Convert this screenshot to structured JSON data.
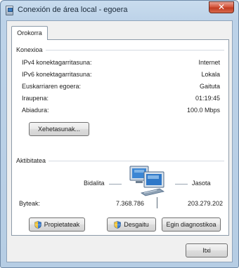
{
  "window": {
    "title": "Conexión de área local - egoera"
  },
  "tabs": [
    {
      "label": "Orokorra"
    }
  ],
  "connection": {
    "label": "Konexioa",
    "rows": [
      {
        "label": "IPv4 konektagarritasuna:",
        "value": "Internet"
      },
      {
        "label": "IPv6 konektagarritasuna:",
        "value": "Lokala"
      },
      {
        "label": "Euskarriaren egoera:",
        "value": "Gaituta"
      },
      {
        "label": "Iraupena:",
        "value": "01:19:45"
      },
      {
        "label": "Abiadura:",
        "value": "100.0 Mbps"
      }
    ],
    "details_button": "Xehetasunak..."
  },
  "activity": {
    "label": "Aktibitatea",
    "sent_label": "Bidalita",
    "received_label": "Jasota",
    "bytes_label": "Byteak:",
    "bytes_sent": "7.368.786",
    "bytes_received": "203.279.202"
  },
  "actions": {
    "properties": "Propietateak",
    "disable": "Desgaitu",
    "diagnose": "Egin diagnostikoa"
  },
  "footer": {
    "close_button": "Itxi"
  },
  "icons": {
    "title": "network-connection-icon",
    "activity": "network-activity-icon",
    "shield": "uac-shield-icon"
  }
}
